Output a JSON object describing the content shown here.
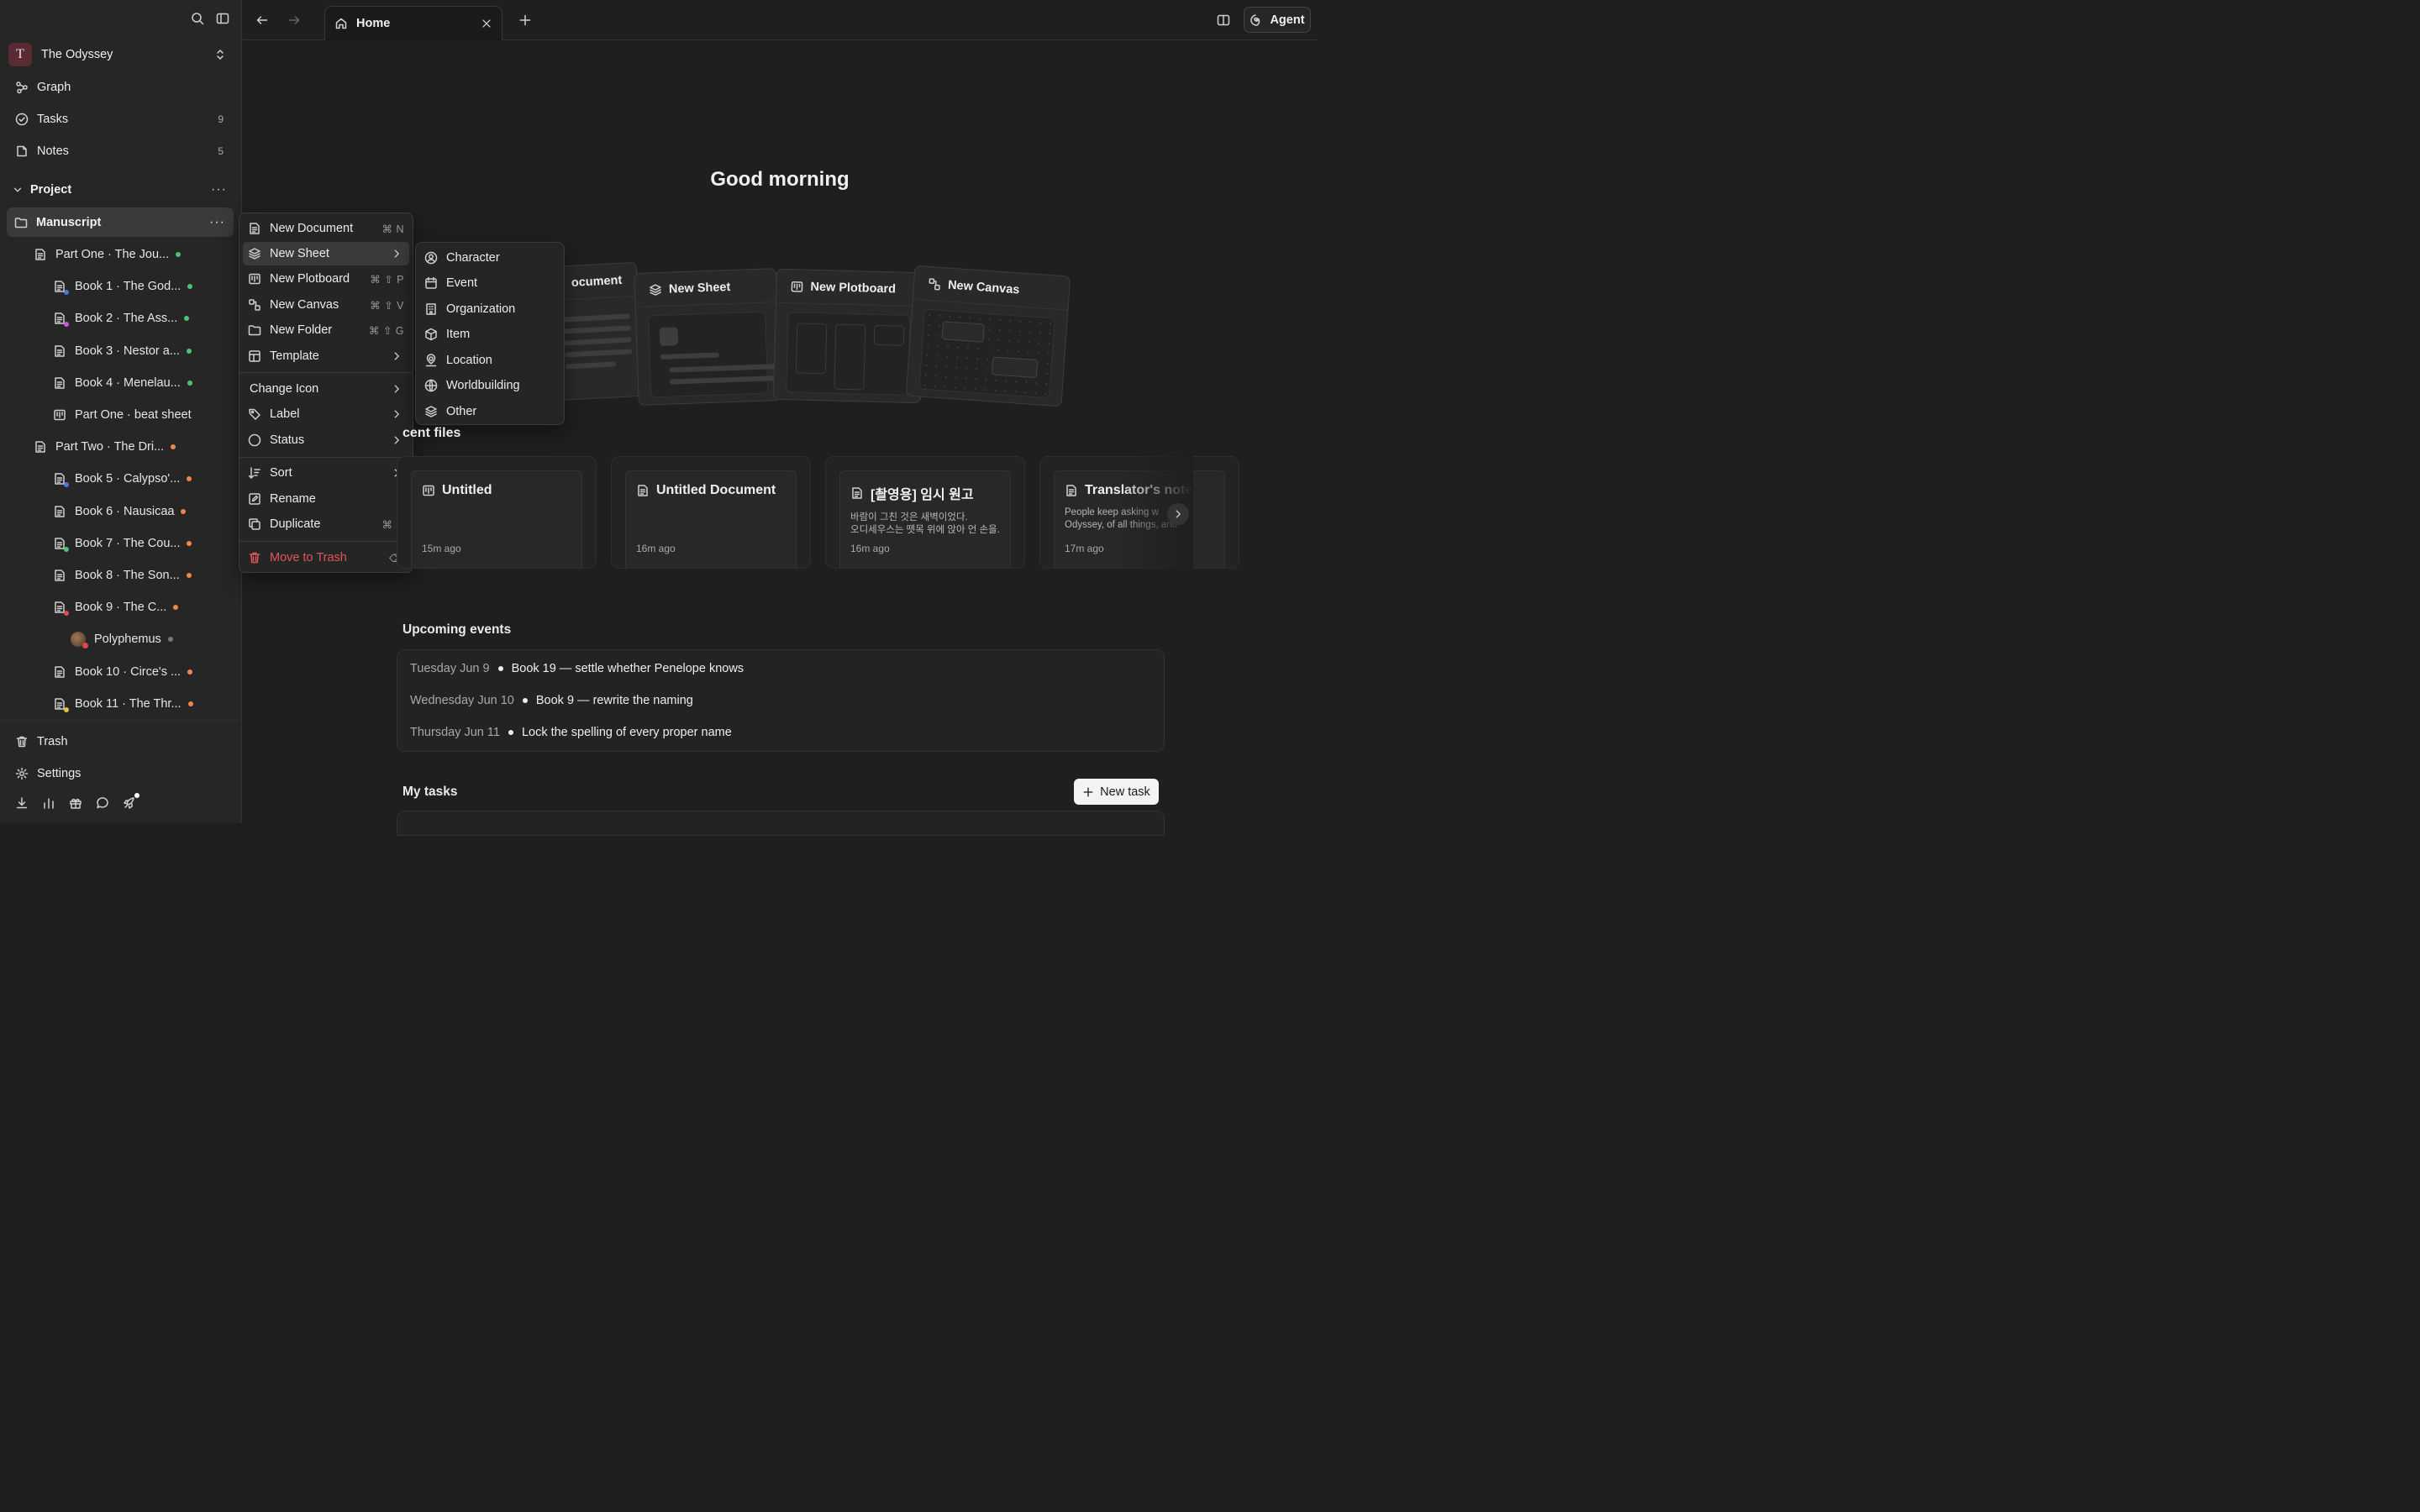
{
  "sidebar": {
    "workspace": {
      "initial": "T",
      "name": "The Odyssey"
    },
    "nav": [
      {
        "label": "Graph",
        "count": ""
      },
      {
        "label": "Tasks",
        "count": "9"
      },
      {
        "label": "Notes",
        "count": "5"
      }
    ],
    "section": {
      "label": "Project"
    },
    "selected_folder": "Manuscript",
    "tree": [
      {
        "label": "Part One · The Jou...",
        "dot": "#4ec27a"
      },
      {
        "label": "Book 1 · The God...",
        "dot": "#4ec27a",
        "badge": "#4a7bd8"
      },
      {
        "label": "Book 2 · The Ass...",
        "dot": "#4ec27a",
        "badge": "#c65bd8"
      },
      {
        "label": "Book 3 · Nestor a...",
        "dot": "#4ec27a"
      },
      {
        "label": "Book 4 · Menelau...",
        "dot": "#4ec27a"
      },
      {
        "label": "Part One · beat sheet",
        "dot": ""
      },
      {
        "label": "Part Two · The Dri...",
        "dot": "#f0874a"
      },
      {
        "label": "Book 5 · Calypso'...",
        "dot": "#f0874a",
        "badge": "#4a7bd8"
      },
      {
        "label": "Book 6 · Nausicaa",
        "dot": "#f0874a"
      },
      {
        "label": "Book 7 · The Cou...",
        "dot": "#f0874a",
        "badge": "#4ec27a"
      },
      {
        "label": "Book 8 · The Son...",
        "dot": "#f0874a"
      },
      {
        "label": "Book 9 · The C...",
        "dot": "#f0874a",
        "badge": "#e04848"
      },
      {
        "label": "Polyphemus",
        "dot": "#777777"
      },
      {
        "label": "Book 10 · Circe's ...",
        "dot": "#f0874a"
      },
      {
        "label": "Book 11 · The Thr...",
        "dot": "#f0874a",
        "badge": "#e8c23a"
      }
    ],
    "trash": "Trash",
    "settings": "Settings"
  },
  "topbar": {
    "tab_label": "Home",
    "agent_label": "Agent"
  },
  "main": {
    "greeting": "Good morning",
    "create_cards": [
      "ocument",
      "New Sheet",
      "New Plotboard",
      "New Canvas"
    ],
    "recent_title": "cent files",
    "recent": [
      {
        "title": "Untitled",
        "excerpt1": "",
        "excerpt2": "",
        "time": "15m ago"
      },
      {
        "title": "Untitled Document",
        "excerpt1": "",
        "excerpt2": "",
        "time": "16m ago"
      },
      {
        "title": "[촬영용] 임시 원고",
        "excerpt1": "바람이 그친 것은 새벽이었다.",
        "excerpt2": "오디세우스는 뗏목 위에 앉아 언 손을...",
        "time": "16m ago"
      },
      {
        "title": "Translator's note",
        "excerpt1": "People keep asking w",
        "excerpt2": "Odyssey, of all things, and",
        "time": "17m ago"
      }
    ],
    "upcoming_title": "Upcoming events",
    "events": [
      {
        "date": "Tuesday Jun 9",
        "name": "Book 19 — settle whether Penelope knows"
      },
      {
        "date": "Wednesday Jun 10",
        "name": "Book 9 — rewrite the naming"
      },
      {
        "date": "Thursday Jun 11",
        "name": "Lock the spelling of every proper name"
      }
    ],
    "tasks_title": "My tasks",
    "new_task": "New task"
  },
  "context_menu": {
    "items": [
      {
        "label": "New Document",
        "shortcut": "⌘ N"
      },
      {
        "label": "New Sheet",
        "shortcut": ""
      },
      {
        "label": "New Plotboard",
        "shortcut": "⌘ ⇧ P"
      },
      {
        "label": "New Canvas",
        "shortcut": "⌘ ⇧ V"
      },
      {
        "label": "New Folder",
        "shortcut": "⌘ ⇧ G"
      },
      {
        "label": "Template",
        "shortcut": ""
      },
      {
        "label": "Change Icon",
        "shortcut": ""
      },
      {
        "label": "Label",
        "shortcut": ""
      },
      {
        "label": "Status",
        "shortcut": ""
      },
      {
        "label": "Sort",
        "shortcut": ""
      },
      {
        "label": "Rename",
        "shortcut": ""
      },
      {
        "label": "Duplicate",
        "shortcut": "⌘ D"
      },
      {
        "label": "Move to Trash",
        "shortcut": "⌫"
      }
    ]
  },
  "submenu": {
    "items": [
      "Character",
      "Event",
      "Organization",
      "Item",
      "Location",
      "Worldbuilding",
      "Other"
    ]
  },
  "colors": {
    "danger": "#e25555",
    "selected_bg": "#3a3a3a"
  }
}
